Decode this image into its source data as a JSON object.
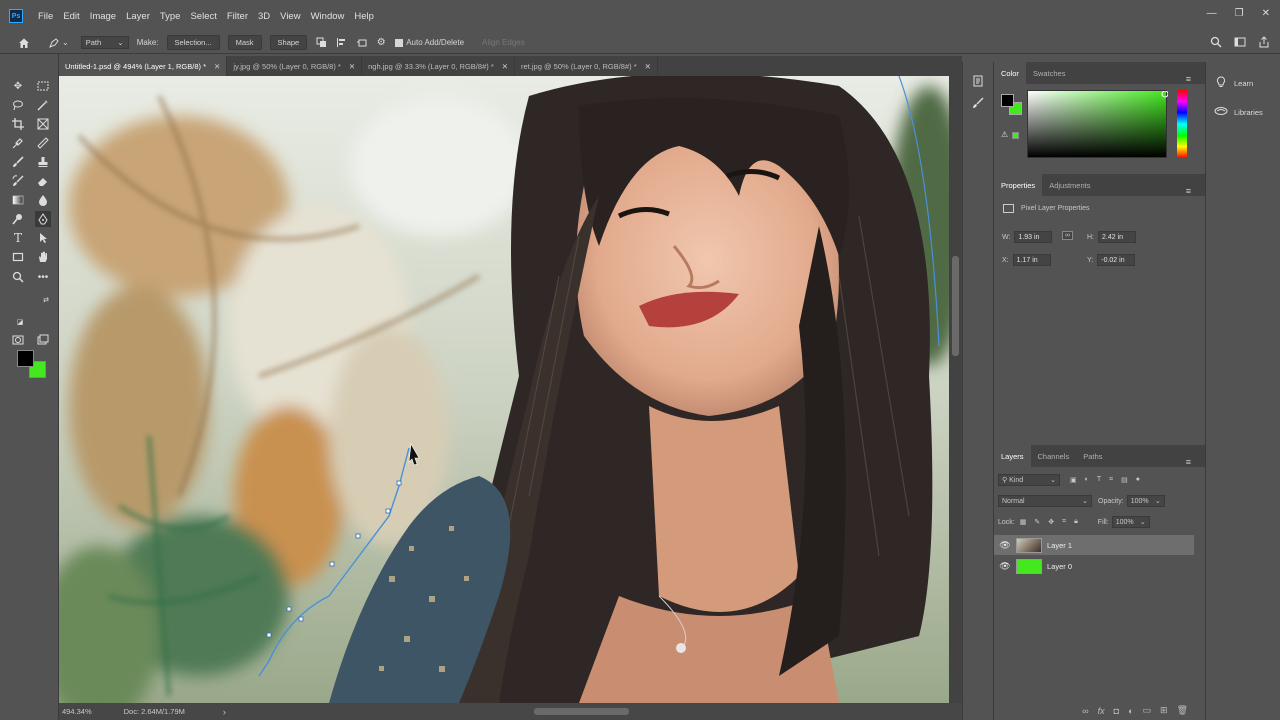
{
  "app": {
    "logo": "Ps"
  },
  "menu": [
    "File",
    "Edit",
    "Image",
    "Layer",
    "Type",
    "Select",
    "Filter",
    "3D",
    "View",
    "Window",
    "Help"
  ],
  "window_controls": {
    "minimize": "—",
    "restore": "❐",
    "close": "✕"
  },
  "options": {
    "mode_value": "Path",
    "make_label": "Make:",
    "selection_btn": "Selection...",
    "mask_btn": "Mask",
    "shape_btn": "Shape",
    "auto_add_delete": "Auto Add/Delete",
    "align_edges": "Align Edges"
  },
  "tabs": [
    {
      "label": "Untitled-1.psd @ 494% (Layer 1, RGB/8) *",
      "active": true
    },
    {
      "label": "jy.jpg @ 50% (Layer 0, RGB/8) *",
      "active": false
    },
    {
      "label": "ngh.jpg @ 33.3% (Layer 0, RGB/8#) *",
      "active": false
    },
    {
      "label": "ret.jpg @ 50% (Layer 0, RGB/8#) *",
      "active": false
    }
  ],
  "status": {
    "zoom": "494.34%",
    "doc": "Doc: 2.64M/1.79M"
  },
  "color_panel": {
    "tabs": [
      "Color",
      "Swatches"
    ],
    "fg": "#000000",
    "bg": "#43e81f"
  },
  "properties": {
    "tabs": [
      "Properties",
      "Adjustments"
    ],
    "title": "Pixel Layer Properties",
    "w_label": "W:",
    "w": "1.93 in",
    "h_label": "H:",
    "h": "2.42 in",
    "x_label": "X:",
    "x": "1.17 in",
    "y_label": "Y:",
    "y": "-0.02 in"
  },
  "layers": {
    "tabs": [
      "Layers",
      "Channels",
      "Paths"
    ],
    "kind": "Kind",
    "blend": "Normal",
    "opacity_label": "Opacity:",
    "opacity": "100%",
    "lock_label": "Lock:",
    "fill_label": "Fill:",
    "fill": "100%",
    "items": [
      {
        "name": "Layer 1",
        "selected": true
      },
      {
        "name": "Layer 0",
        "selected": false,
        "color": "#43e81f"
      }
    ]
  },
  "right_panel": {
    "learn": "Learn",
    "libraries": "Libraries"
  }
}
